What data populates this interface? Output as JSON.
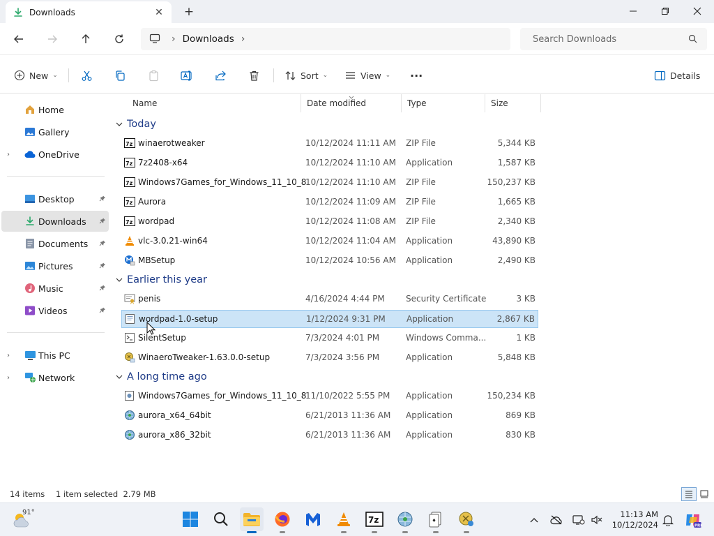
{
  "window": {
    "tab_title": "Downloads",
    "tab_close": "✕",
    "new_tab": "+",
    "minimize": "—",
    "maximize": "▢",
    "close": "✕"
  },
  "address": {
    "crumb": "Downloads",
    "sep1": "›",
    "sep2": "›",
    "search_placeholder": "Search Downloads"
  },
  "toolbar": {
    "new_label": "New",
    "sort_label": "Sort",
    "view_label": "View",
    "more_label": "···",
    "details_label": "Details",
    "caret": "⌄"
  },
  "sidebar": {
    "items": [
      {
        "label": "Home",
        "icon": "home-icon",
        "pinned": false,
        "expander": false
      },
      {
        "label": "Gallery",
        "icon": "gallery-icon",
        "pinned": false,
        "expander": false
      },
      {
        "label": "OneDrive",
        "icon": "cloud-icon",
        "pinned": false,
        "expander": true
      },
      {
        "label": "Desktop",
        "icon": "desktop-icon",
        "pinned": true,
        "expander": false
      },
      {
        "label": "Downloads",
        "icon": "download-icon",
        "pinned": true,
        "expander": false,
        "selected": true
      },
      {
        "label": "Documents",
        "icon": "documents-icon",
        "pinned": true,
        "expander": false
      },
      {
        "label": "Pictures",
        "icon": "pictures-icon",
        "pinned": true,
        "expander": false
      },
      {
        "label": "Music",
        "icon": "music-icon",
        "pinned": true,
        "expander": false
      },
      {
        "label": "Videos",
        "icon": "videos-icon",
        "pinned": true,
        "expander": false
      },
      {
        "label": "This PC",
        "icon": "pc-icon",
        "pinned": false,
        "expander": true
      },
      {
        "label": "Network",
        "icon": "network-icon",
        "pinned": false,
        "expander": true
      }
    ],
    "expander_glyph": "›",
    "pin_glyph": "📌"
  },
  "columns": {
    "name": "Name",
    "date": "Date modified",
    "type": "Type",
    "size": "Size"
  },
  "groups": [
    {
      "label": "Today",
      "files": [
        {
          "name": "winaerotweaker",
          "date": "10/12/2024 11:11 AM",
          "type": "ZIP File",
          "size": "5,344 KB",
          "icon": "zip-icon"
        },
        {
          "name": "7z2408-x64",
          "date": "10/12/2024 11:10 AM",
          "type": "Application",
          "size": "1,587 KB",
          "icon": "7zip-icon"
        },
        {
          "name": "Windows7Games_for_Windows_11_10_8",
          "date": "10/12/2024 11:10 AM",
          "type": "ZIP File",
          "size": "150,237 KB",
          "icon": "zip-icon"
        },
        {
          "name": "Aurora",
          "date": "10/12/2024 11:09 AM",
          "type": "ZIP File",
          "size": "1,665 KB",
          "icon": "zip-icon"
        },
        {
          "name": "wordpad",
          "date": "10/12/2024 11:08 AM",
          "type": "ZIP File",
          "size": "2,340 KB",
          "icon": "zip-icon"
        },
        {
          "name": "vlc-3.0.21-win64",
          "date": "10/12/2024 11:04 AM",
          "type": "Application",
          "size": "43,890 KB",
          "icon": "vlc-icon"
        },
        {
          "name": "MBSetup",
          "date": "10/12/2024 10:56 AM",
          "type": "Application",
          "size": "2,490 KB",
          "icon": "malwarebytes-icon"
        }
      ]
    },
    {
      "label": "Earlier this year",
      "files": [
        {
          "name": "penis",
          "date": "4/16/2024 4:44 PM",
          "type": "Security Certificate",
          "size": "3 KB",
          "icon": "certificate-icon"
        },
        {
          "name": "wordpad-1.0-setup",
          "date": "1/12/2024 9:31 PM",
          "type": "Application",
          "size": "2,867 KB",
          "icon": "setup-icon",
          "selected": true
        },
        {
          "name": "SilentSetup",
          "date": "7/3/2024 4:01 PM",
          "type": "Windows Comma...",
          "size": "1 KB",
          "icon": "script-icon"
        },
        {
          "name": "WinaeroTweaker-1.63.0.0-setup",
          "date": "7/3/2024 3:56 PM",
          "type": "Application",
          "size": "5,848 KB",
          "icon": "installer-icon"
        }
      ]
    },
    {
      "label": "A long time ago",
      "files": [
        {
          "name": "Windows7Games_for_Windows_11_10_8",
          "date": "11/10/2022 5:55 PM",
          "type": "Application",
          "size": "150,234 KB",
          "icon": "setup-icon"
        },
        {
          "name": "aurora_x64_64bit",
          "date": "6/21/2013 11:36 AM",
          "type": "Application",
          "size": "869 KB",
          "icon": "globe-app-icon"
        },
        {
          "name": "aurora_x86_32bit",
          "date": "6/21/2013 11:36 AM",
          "type": "Application",
          "size": "830 KB",
          "icon": "globe-app-icon"
        }
      ]
    }
  ],
  "status": {
    "items": "14 items",
    "selection": "1 item selected  2.79 MB"
  },
  "taskbar": {
    "temperature": "91°",
    "time": "11:13 AM",
    "date": "10/12/2024"
  },
  "colors": {
    "accent": "#0067c0",
    "selection": "#cce4f7",
    "group_header": "#1f3c88"
  }
}
